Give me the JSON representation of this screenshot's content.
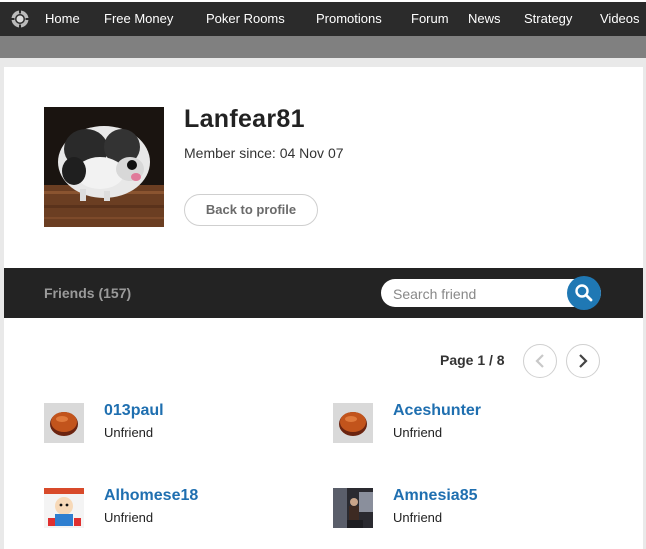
{
  "nav": {
    "items": [
      "Home",
      "Free Money",
      "Poker Rooms",
      "Promotions",
      "Forum",
      "News",
      "Strategy",
      "Videos"
    ],
    "logo_icon": "poker-chip-icon"
  },
  "profile": {
    "username": "Lanfear81",
    "member_since": "Member since: 04 Nov 07",
    "back_label": "Back to profile"
  },
  "friends": {
    "title": "Friends (157)",
    "search_placeholder": "Search friend",
    "search_icon": "search-icon",
    "page_label": "Page 1 / 8",
    "prev_icon": "chevron-left-icon",
    "next_icon": "chevron-right-icon",
    "list": [
      {
        "name": "013paul",
        "action": "Unfriend",
        "avatar": "poker-chip-avatar"
      },
      {
        "name": "Aceshunter",
        "action": "Unfriend",
        "avatar": "poker-chip-avatar"
      },
      {
        "name": "Alhomese18",
        "action": "Unfriend",
        "avatar": "cartoon-avatar"
      },
      {
        "name": "Amnesia85",
        "action": "Unfriend",
        "avatar": "photo-avatar"
      }
    ]
  },
  "colors": {
    "nav_bg": "#2b2b2b",
    "friends_bar_bg": "#232323",
    "link_blue": "#1f6fb0",
    "search_button": "#1f78b4"
  }
}
